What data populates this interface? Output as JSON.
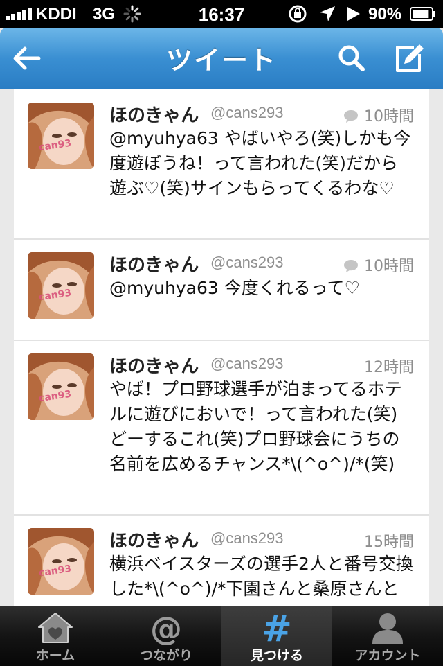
{
  "status_bar": {
    "carrier": "KDDI",
    "network": "3G",
    "time": "16:37",
    "battery_percent": "90%",
    "battery_level": 0.9
  },
  "nav": {
    "title": "ツイート",
    "icons": {
      "back": "back-arrow-icon",
      "search": "search-icon",
      "compose": "compose-icon"
    }
  },
  "tweets": [
    {
      "name": "ほのきゃん",
      "handle": "@cans293",
      "time": "10時間",
      "has_reply_icon": true,
      "avatar_watermark": "can93",
      "text": "@myuhya63 やばいやろ(笑)しかも今度遊ぼうね！って言われた(笑)だから遊ぶ♡(笑)サインもらってくるわな♡"
    },
    {
      "name": "ほのきゃん",
      "handle": "@cans293",
      "time": "10時間",
      "has_reply_icon": true,
      "avatar_watermark": "can93",
      "text": "@myuhya63 今度くれるって♡"
    },
    {
      "name": "ほのきゃん",
      "handle": "@cans293",
      "time": "12時間",
      "has_reply_icon": false,
      "avatar_watermark": "can93",
      "text": "やば！プロ野球選手が泊まってるホテルに遊びにおいで！って言われた(笑)どーするこれ(笑)プロ野球会にうちの名前を広めるチャンス*\\(^o^)/*(笑)"
    },
    {
      "name": "ほのきゃん",
      "handle": "@cans293",
      "time": "15時間",
      "has_reply_icon": false,
      "avatar_watermark": "can93",
      "text": "横浜ベイスターズの選手2人と番号交換した*\\(^o^)/*下園さんと桑原さんと"
    }
  ],
  "tabs": [
    {
      "label": "ホーム",
      "icon": "home-icon",
      "active": false
    },
    {
      "label": "つながり",
      "icon": "at-sign-icon",
      "active": false
    },
    {
      "label": "見つける",
      "icon": "hashtag-icon",
      "active": true
    },
    {
      "label": "アカウント",
      "icon": "person-icon",
      "active": false
    }
  ],
  "colors": {
    "nav_blue": "#3a8fd2",
    "active_tab_icon": "#4aa3e6",
    "meta_gray": "#8e8e8e"
  }
}
